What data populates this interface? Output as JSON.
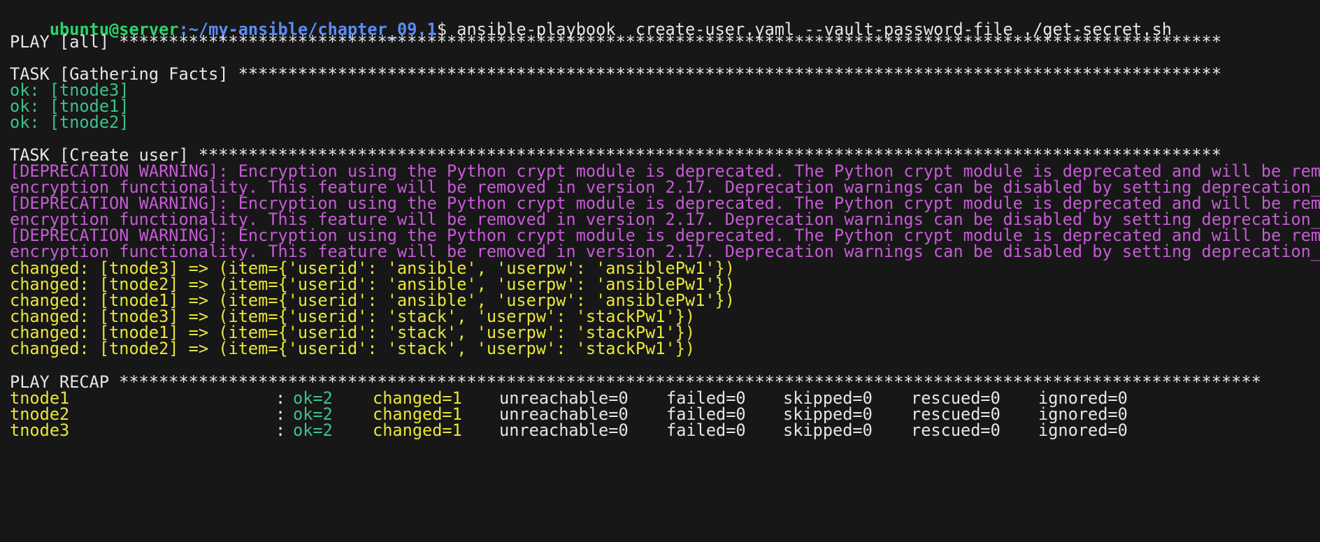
{
  "prompt": {
    "user_host": "ubuntu@server",
    "path": ":~/my-ansible/chapter_09.1",
    "symbol": "$",
    "command": " ansible-playbook  create-user.yaml --vault-password-file ./get-secret.sh"
  },
  "play": {
    "header": "PLAY [all] ***************************************************************************************************************"
  },
  "task_facts": {
    "header": "TASK [Gathering Facts] ***************************************************************************************************",
    "results": [
      "ok: [tnode3]",
      "ok: [tnode1]",
      "ok: [tnode2]"
    ]
  },
  "task_create": {
    "header": "TASK [Create user] *******************************************************************************************************",
    "warnings": [
      "[DEPRECATION WARNING]: Encryption using the Python crypt module is deprecated. The Python crypt module is deprecated and will be removed",
      "encryption functionality. This feature will be removed in version 2.17. Deprecation warnings can be disabled by setting deprecation_warnings",
      "[DEPRECATION WARNING]: Encryption using the Python crypt module is deprecated. The Python crypt module is deprecated and will be removed",
      "encryption functionality. This feature will be removed in version 2.17. Deprecation warnings can be disabled by setting deprecation_warnings",
      "[DEPRECATION WARNING]: Encryption using the Python crypt module is deprecated. The Python crypt module is deprecated and will be removed",
      "encryption functionality. This feature will be removed in version 2.17. Deprecation warnings can be disabled by setting deprecation_warnings"
    ],
    "changes": [
      "changed: [tnode3] => (item={'userid': 'ansible', 'userpw': 'ansiblePw1'})",
      "changed: [tnode2] => (item={'userid': 'ansible', 'userpw': 'ansiblePw1'})",
      "changed: [tnode1] => (item={'userid': 'ansible', 'userpw': 'ansiblePw1'})",
      "changed: [tnode3] => (item={'userid': 'stack', 'userpw': 'stackPw1'})",
      "changed: [tnode1] => (item={'userid': 'stack', 'userpw': 'stackPw1'})",
      "changed: [tnode2] => (item={'userid': 'stack', 'userpw': 'stackPw1'})"
    ]
  },
  "recap": {
    "header": "PLAY RECAP *******************************************************************************************************************",
    "rows": [
      {
        "host": "tnode1",
        "sep": ":",
        "ok": "ok=2",
        "changed": "changed=1",
        "unreachable": "unreachable=0",
        "failed": "failed=0",
        "skipped": "skipped=0",
        "rescued": "rescued=0",
        "ignored": "ignored=0"
      },
      {
        "host": "tnode2",
        "sep": ":",
        "ok": "ok=2",
        "changed": "changed=1",
        "unreachable": "unreachable=0",
        "failed": "failed=0",
        "skipped": "skipped=0",
        "rescued": "rescued=0",
        "ignored": "ignored=0"
      },
      {
        "host": "tnode3",
        "sep": ":",
        "ok": "ok=2",
        "changed": "changed=1",
        "unreachable": "unreachable=0",
        "failed": "failed=0",
        "skipped": "skipped=0",
        "rescued": "rescued=0",
        "ignored": "ignored=0"
      }
    ]
  },
  "colors": {
    "background": "#171717",
    "prompt_user": "#2bd36a",
    "prompt_path": "#5b8df7",
    "ok": "#3bc48c",
    "warning": "#c65bd6",
    "changed": "#e9e63b",
    "text": "#e6e6e6"
  }
}
